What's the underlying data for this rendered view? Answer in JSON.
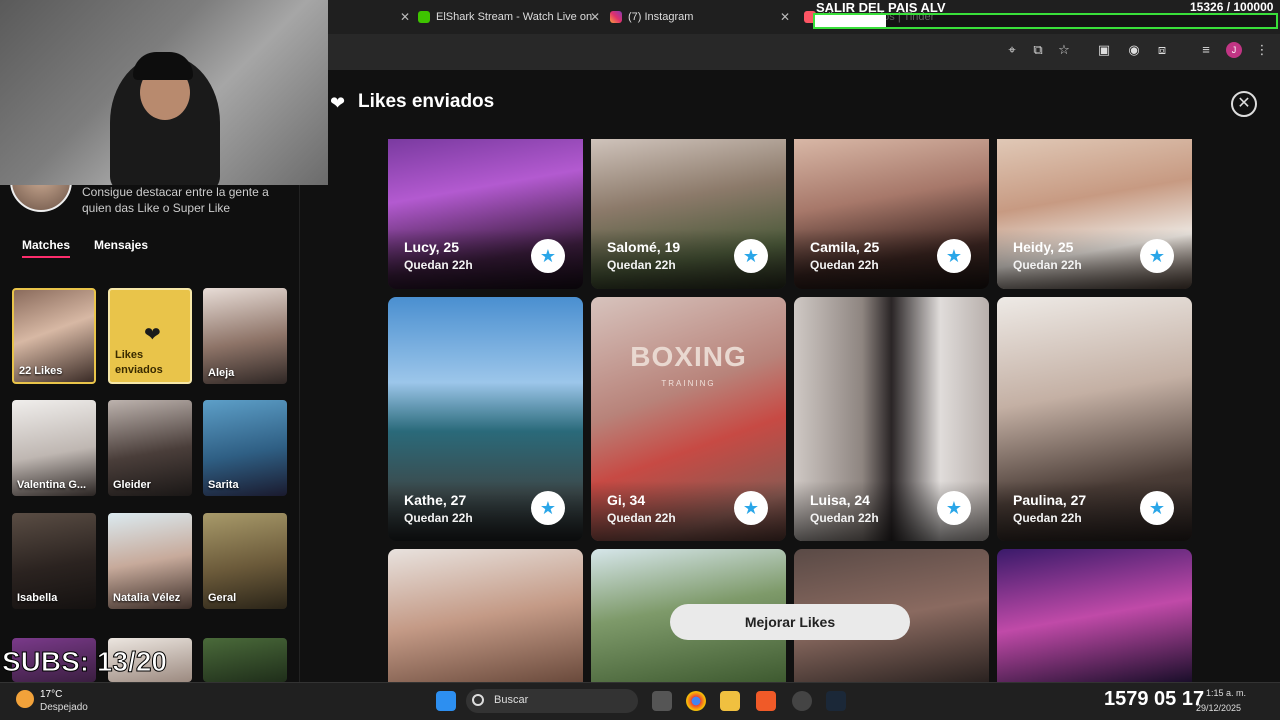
{
  "browser": {
    "tabs": [
      {
        "label": "ElShark Stream - Watch Live on"
      },
      {
        "label": "(7) Instagram"
      },
      {
        "label": "Likes enviados | Tinder"
      }
    ]
  },
  "stream_overlay": {
    "title": "SALIR DEL PAIS ALV",
    "count": "15326  / 100000",
    "progress_fraction": 0.15326,
    "subs": "SUBS: 13/20"
  },
  "sidebar": {
    "promo_text": "Consigue destacar entre la gente a quien das Like o Super Like",
    "tabs": [
      "Matches",
      "Mensajes"
    ],
    "matches": [
      {
        "name": "22 Likes"
      },
      {
        "name": "Likes enviados"
      },
      {
        "name": "Aleja"
      },
      {
        "name": "Valentina G..."
      },
      {
        "name": "Gleider"
      },
      {
        "name": "Sarita"
      },
      {
        "name": "Isabella"
      },
      {
        "name": "Natalia Vélez"
      },
      {
        "name": "Geral"
      }
    ]
  },
  "modal": {
    "title": "Likes enviados",
    "upgrade_button": "Mejorar Likes"
  },
  "profiles": [
    {
      "name": "Lucy, 25",
      "remaining": "Quedan 22h"
    },
    {
      "name": "Salomé, 19",
      "remaining": "Quedan 22h"
    },
    {
      "name": "Camila, 25",
      "remaining": "Quedan 22h"
    },
    {
      "name": "Heidy, 25",
      "remaining": "Quedan 22h"
    },
    {
      "name": "Kathe, 27",
      "remaining": "Quedan 22h"
    },
    {
      "name": "Gi, 34",
      "remaining": "Quedan 22h"
    },
    {
      "name": "Luisa, 24",
      "remaining": "Quedan 22h"
    },
    {
      "name": "Paulina, 27",
      "remaining": "Quedan 22h"
    }
  ],
  "boxing_card": {
    "headline": "BOXING",
    "subline": "TRAINING"
  },
  "taskbar": {
    "temperature": "17°C",
    "condition": "Despejado",
    "search_label": "Buscar",
    "clock_large": "1579 05 17",
    "clock_time": "1:15 a. m.",
    "clock_date": "29/12/2025"
  },
  "colors": {
    "accent": "#fd2d6c",
    "gold": "#e9c44a",
    "star_blue": "#2aa6e8",
    "progress_border": "#39e03a"
  }
}
